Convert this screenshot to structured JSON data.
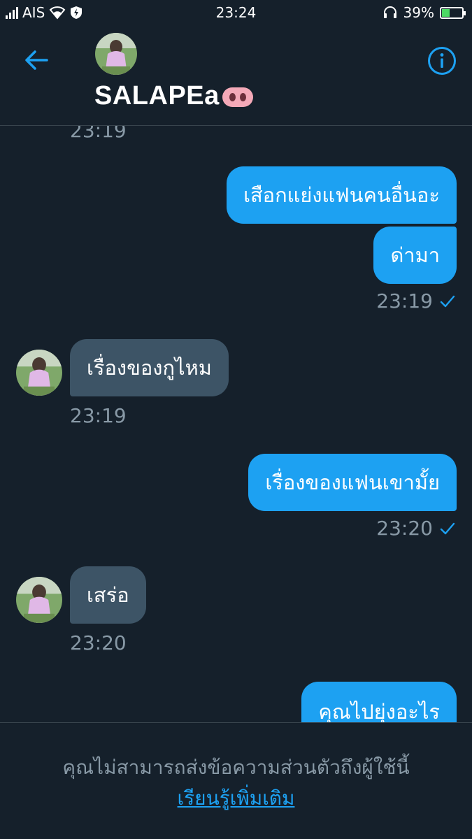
{
  "status_bar": {
    "carrier": "AIS",
    "time": "23:24",
    "battery_percent": "39%",
    "battery_level": 0.39,
    "icons": [
      "signal-icon",
      "wifi-icon",
      "shield-icon",
      "headset-icon",
      "battery-icon"
    ]
  },
  "header": {
    "back_icon": "back-arrow-icon",
    "name": "SALAPEa",
    "name_emoji": "pig-nose-icon",
    "info_icon": "info-icon"
  },
  "colors": {
    "background": "#15202b",
    "sent_bubble": "#1da1f2",
    "received_bubble": "#3d5466",
    "muted_text": "#8899a6",
    "accent": "#1da1f2"
  },
  "conversation": {
    "top_partial_timestamp": "23:19",
    "messages": [
      {
        "direction": "sent",
        "text": "เสือกแย่งแฟนคนอื่นอะ"
      },
      {
        "direction": "sent",
        "text": "ด่ามา",
        "timestamp": "23:19",
        "read": true
      },
      {
        "direction": "received",
        "text": "เรื่องของกูไหม",
        "timestamp": "23:19"
      },
      {
        "direction": "sent",
        "text": "เรื่องของแฟนเขามั้ย",
        "timestamp": "23:20",
        "read": true
      },
      {
        "direction": "received",
        "text": "เสร่อ",
        "timestamp": "23:20"
      },
      {
        "direction": "sent",
        "text": "คุณไปยุ่งอะไร"
      }
    ]
  },
  "footer": {
    "notice": "คุณไม่สามารถส่งข้อความส่วนตัวถึงผู้ใช้นี้",
    "learn_more": "เรียนรู้เพิ่มเติม"
  }
}
